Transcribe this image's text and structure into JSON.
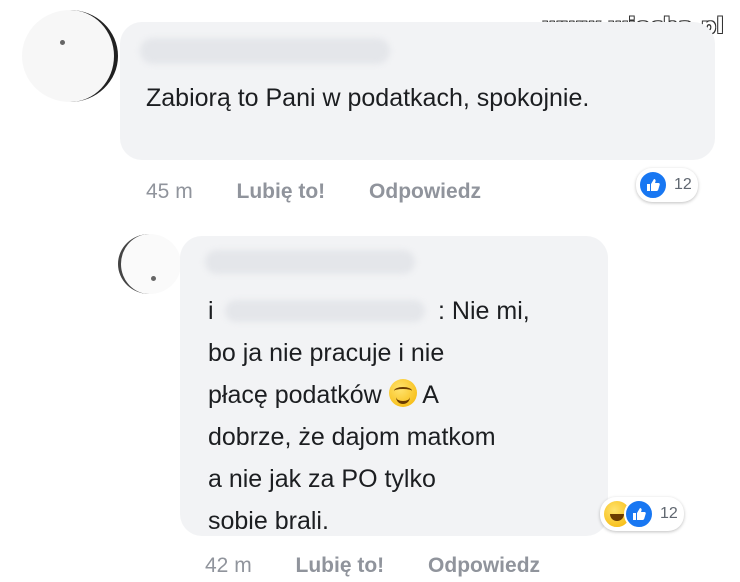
{
  "watermark": "www.wiocha.pl",
  "comments": [
    {
      "text": "Zabiorą to Pani w podatkach, spokojnie.",
      "time": "45 m",
      "like_label": "Lubię to!",
      "reply_label": "Odpowiedz",
      "reaction_count": "12",
      "reactions": [
        "like-icon"
      ]
    },
    {
      "text_start": ":",
      "text_lines": [
        "Nie mi,",
        "bo ja nie pracuje i nie",
        "płacę podatków"
      ],
      "text_after_emoji": "A",
      "text_end": [
        "dobrze, że dajom matkom",
        "a nie jak za PO tylko",
        "sobie brali."
      ],
      "time": "42 m",
      "like_label": "Lubię to!",
      "reply_label": "Odpowiedz",
      "reaction_count": "12",
      "reactions": [
        "haha-icon",
        "like-icon"
      ]
    }
  ],
  "colors": {
    "bubble": "#f2f3f5",
    "meta_text": "#90949c",
    "like_blue": "#1877f2"
  }
}
